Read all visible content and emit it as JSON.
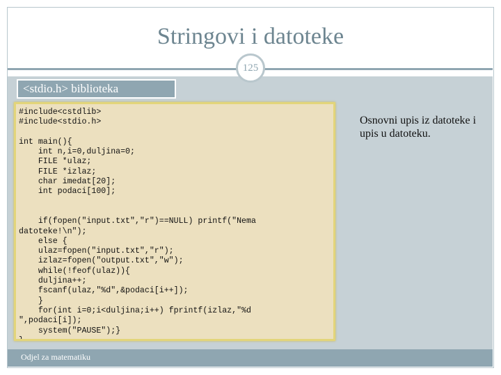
{
  "slide": {
    "title": "Stringovi i datoteke",
    "page_number": "125",
    "heading": "<stdio.h> biblioteka",
    "code": "#include<cstdlib>\n#include<stdio.h>\n\nint main(){\n    int n,i=0,duljina=0;\n    FILE *ulaz;\n    FILE *izlaz;\n    char imedat[20];\n    int podaci[100];\n\n\n    if(fopen(\"input.txt\",\"r\")==NULL) printf(\"Nema\ndatoteke!\\n\");\n    else {\n    ulaz=fopen(\"input.txt\",\"r\");\n    izlaz=fopen(\"output.txt\",\"w\");\n    while(!feof(ulaz)){\n    duljina++;\n    fscanf(ulaz,\"%d\",&podaci[i++]);\n    }\n    for(int i=0;i<duljina;i++) fprintf(izlaz,\"%d\n\",podaci[i]);\n    system(\"PAUSE\");}\n}",
    "side_text": "Osnovni upis iz datoteke i upis u datoteku.",
    "footer": "Odjel za matematiku"
  },
  "colors": {
    "title": "#6d8590",
    "band": "#8fa6b1",
    "content_background": "#c6d1d6",
    "code_background": "#ece0bf",
    "code_border": "#e3d57a"
  }
}
